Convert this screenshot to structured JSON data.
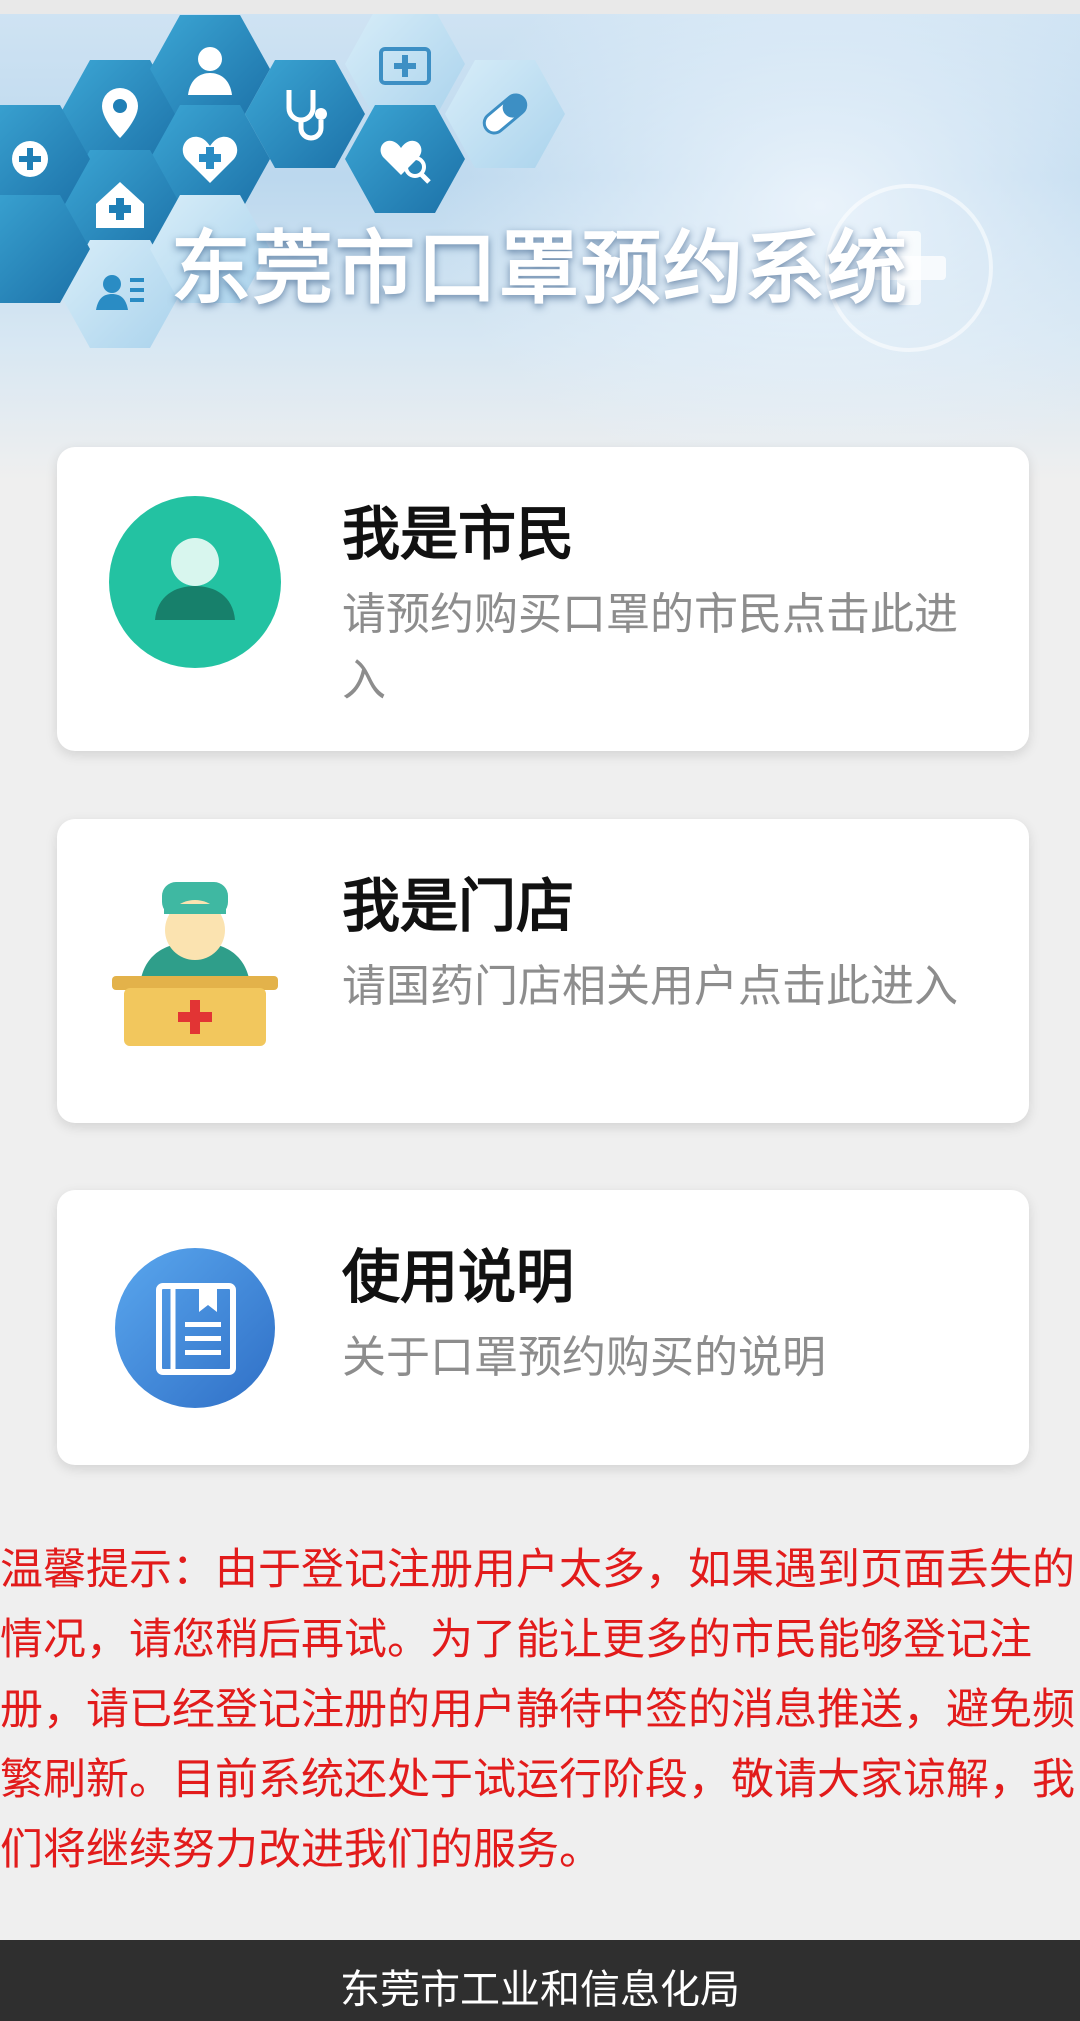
{
  "banner": {
    "title": "东莞市口罩预约系统"
  },
  "cards": [
    {
      "title": "我是市民",
      "desc": "请预约购买口罩的市民点击此进入",
      "icon": "citizen-person-icon"
    },
    {
      "title": "我是门店",
      "desc": "请国药门店相关用户点击此进入",
      "icon": "pharmacy-staff-icon"
    },
    {
      "title": "使用说明",
      "desc": "关于口罩预约购买的说明",
      "icon": "manual-book-icon"
    }
  ],
  "notice": {
    "text": "温馨提示：由于登记注册用户太多，如果遇到页面丢失的情况，请您稍后再试。为了能让更多的市民能够登记注册，请已经登记注册的用户静待中签的消息推送，避免频繁刷新。目前系统还处于试运行阶段，敬请大家谅解，我们将继续努力改进我们的服务。"
  },
  "footer": {
    "text": "东莞市工业和信息化局"
  },
  "colors": {
    "citizen_icon": "#23c2a2",
    "notice_text": "#e21b1b",
    "footer_bg": "#2f2f2f",
    "manual_icon": "#3f86d9"
  }
}
